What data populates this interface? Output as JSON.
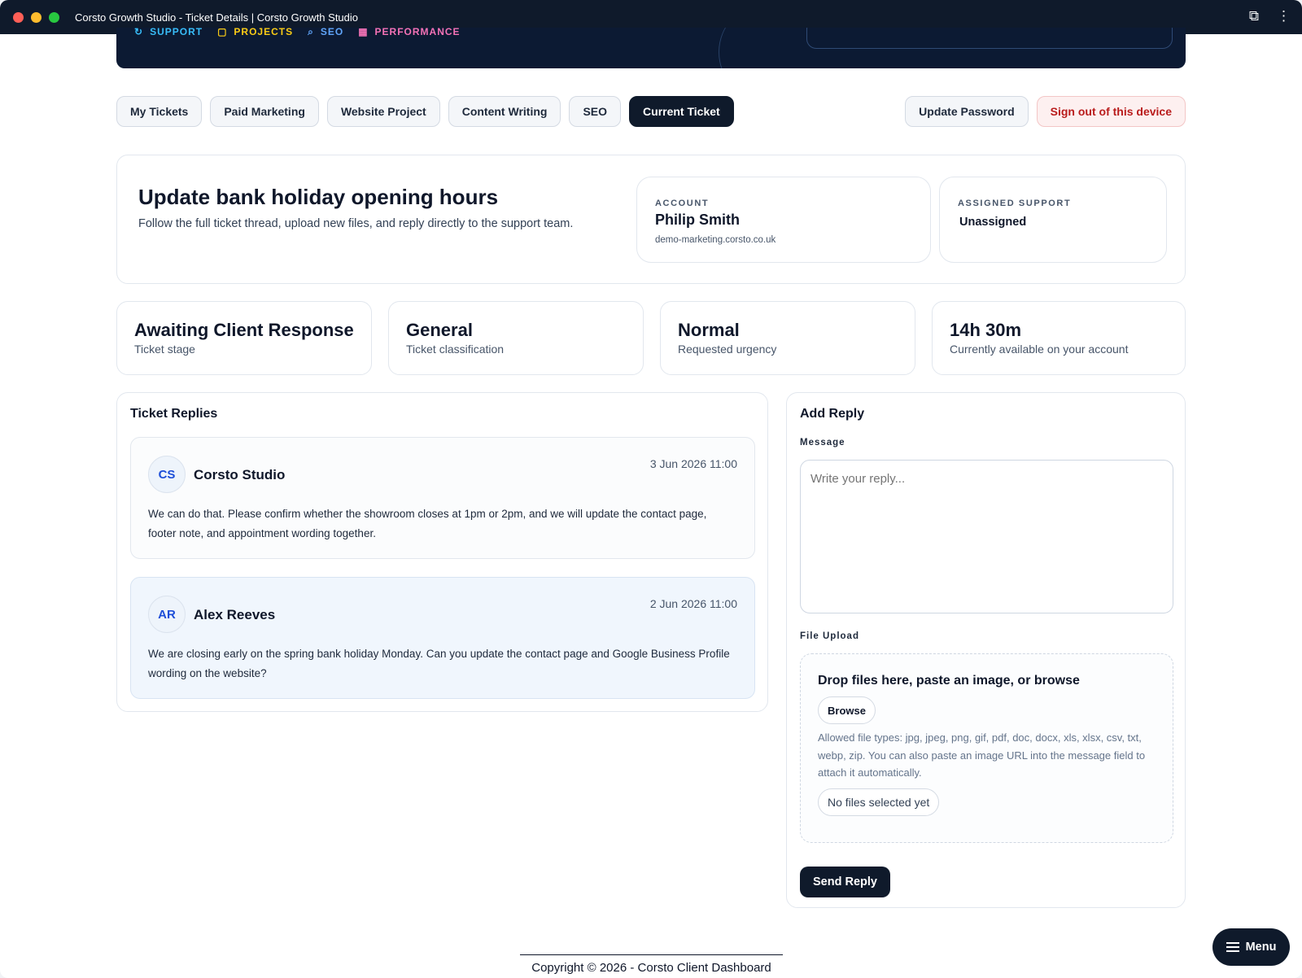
{
  "window": {
    "title": "Corsto Growth Studio - Ticket Details | Corsto Growth Studio"
  },
  "hero_nav": [
    {
      "label": "SUPPORT",
      "icon": "support-icon",
      "color": "#38bdf8"
    },
    {
      "label": "PROJECTS",
      "icon": "folder-icon",
      "color": "#facc15"
    },
    {
      "label": "SEO",
      "icon": "search-icon",
      "color": "#60a5fa"
    },
    {
      "label": "PERFORMANCE",
      "icon": "chart-icon",
      "color": "#f472b6"
    }
  ],
  "tabs": [
    {
      "label": "My Tickets",
      "active": false
    },
    {
      "label": "Paid Marketing",
      "active": false
    },
    {
      "label": "Website Project",
      "active": false
    },
    {
      "label": "Content Writing",
      "active": false
    },
    {
      "label": "SEO",
      "active": false
    },
    {
      "label": "Current Ticket",
      "active": true
    }
  ],
  "account_actions": {
    "update_password": "Update Password",
    "sign_out": "Sign out of this device"
  },
  "ticket": {
    "title": "Update bank holiday opening hours",
    "subtitle": "Follow the full ticket thread, upload new files, and reply directly to the support team."
  },
  "account": {
    "label": "ACCOUNT",
    "name": "Philip Smith",
    "domain": "demo-marketing.corsto.co.uk"
  },
  "support": {
    "label": "ASSIGNED SUPPORT",
    "value": "Unassigned"
  },
  "stats": [
    {
      "value": "Awaiting Client Response",
      "label": "Ticket stage"
    },
    {
      "value": "General",
      "label": "Ticket classification"
    },
    {
      "value": "Normal",
      "label": "Requested urgency"
    },
    {
      "value": "14h 30m",
      "label": "Currently available on your account"
    }
  ],
  "replies": {
    "title": "Ticket Replies",
    "items": [
      {
        "initials": "CS",
        "author": "Corsto Studio",
        "date": "3 Jun 2026 11:00",
        "body": "We can do that. Please confirm whether the showroom closes at 1pm or 2pm, and we will update the contact page, footer note, and appointment wording together."
      },
      {
        "initials": "AR",
        "author": "Alex Reeves",
        "date": "2 Jun 2026 11:00",
        "body": "We are closing early on the spring bank holiday Monday. Can you update the contact page and Google Business Profile wording on the website?"
      }
    ]
  },
  "add_reply": {
    "title": "Add Reply",
    "message_label": "Message",
    "message_placeholder": "Write your reply...",
    "upload_label": "File Upload",
    "dropzone_title": "Drop files here, paste an image, or browse",
    "browse_label": "Browse",
    "hint": "Allowed file types: jpg, jpeg, png, gif, pdf, doc, docx, xls, xlsx, csv, txt, webp, zip. You can also paste an image URL into the message field to attach it automatically.",
    "no_files": "No files selected yet",
    "send_label": "Send Reply"
  },
  "footer": {
    "copyright": "Copyright © 2026 - Corsto Client Dashboard"
  },
  "menu": {
    "label": "Menu"
  }
}
